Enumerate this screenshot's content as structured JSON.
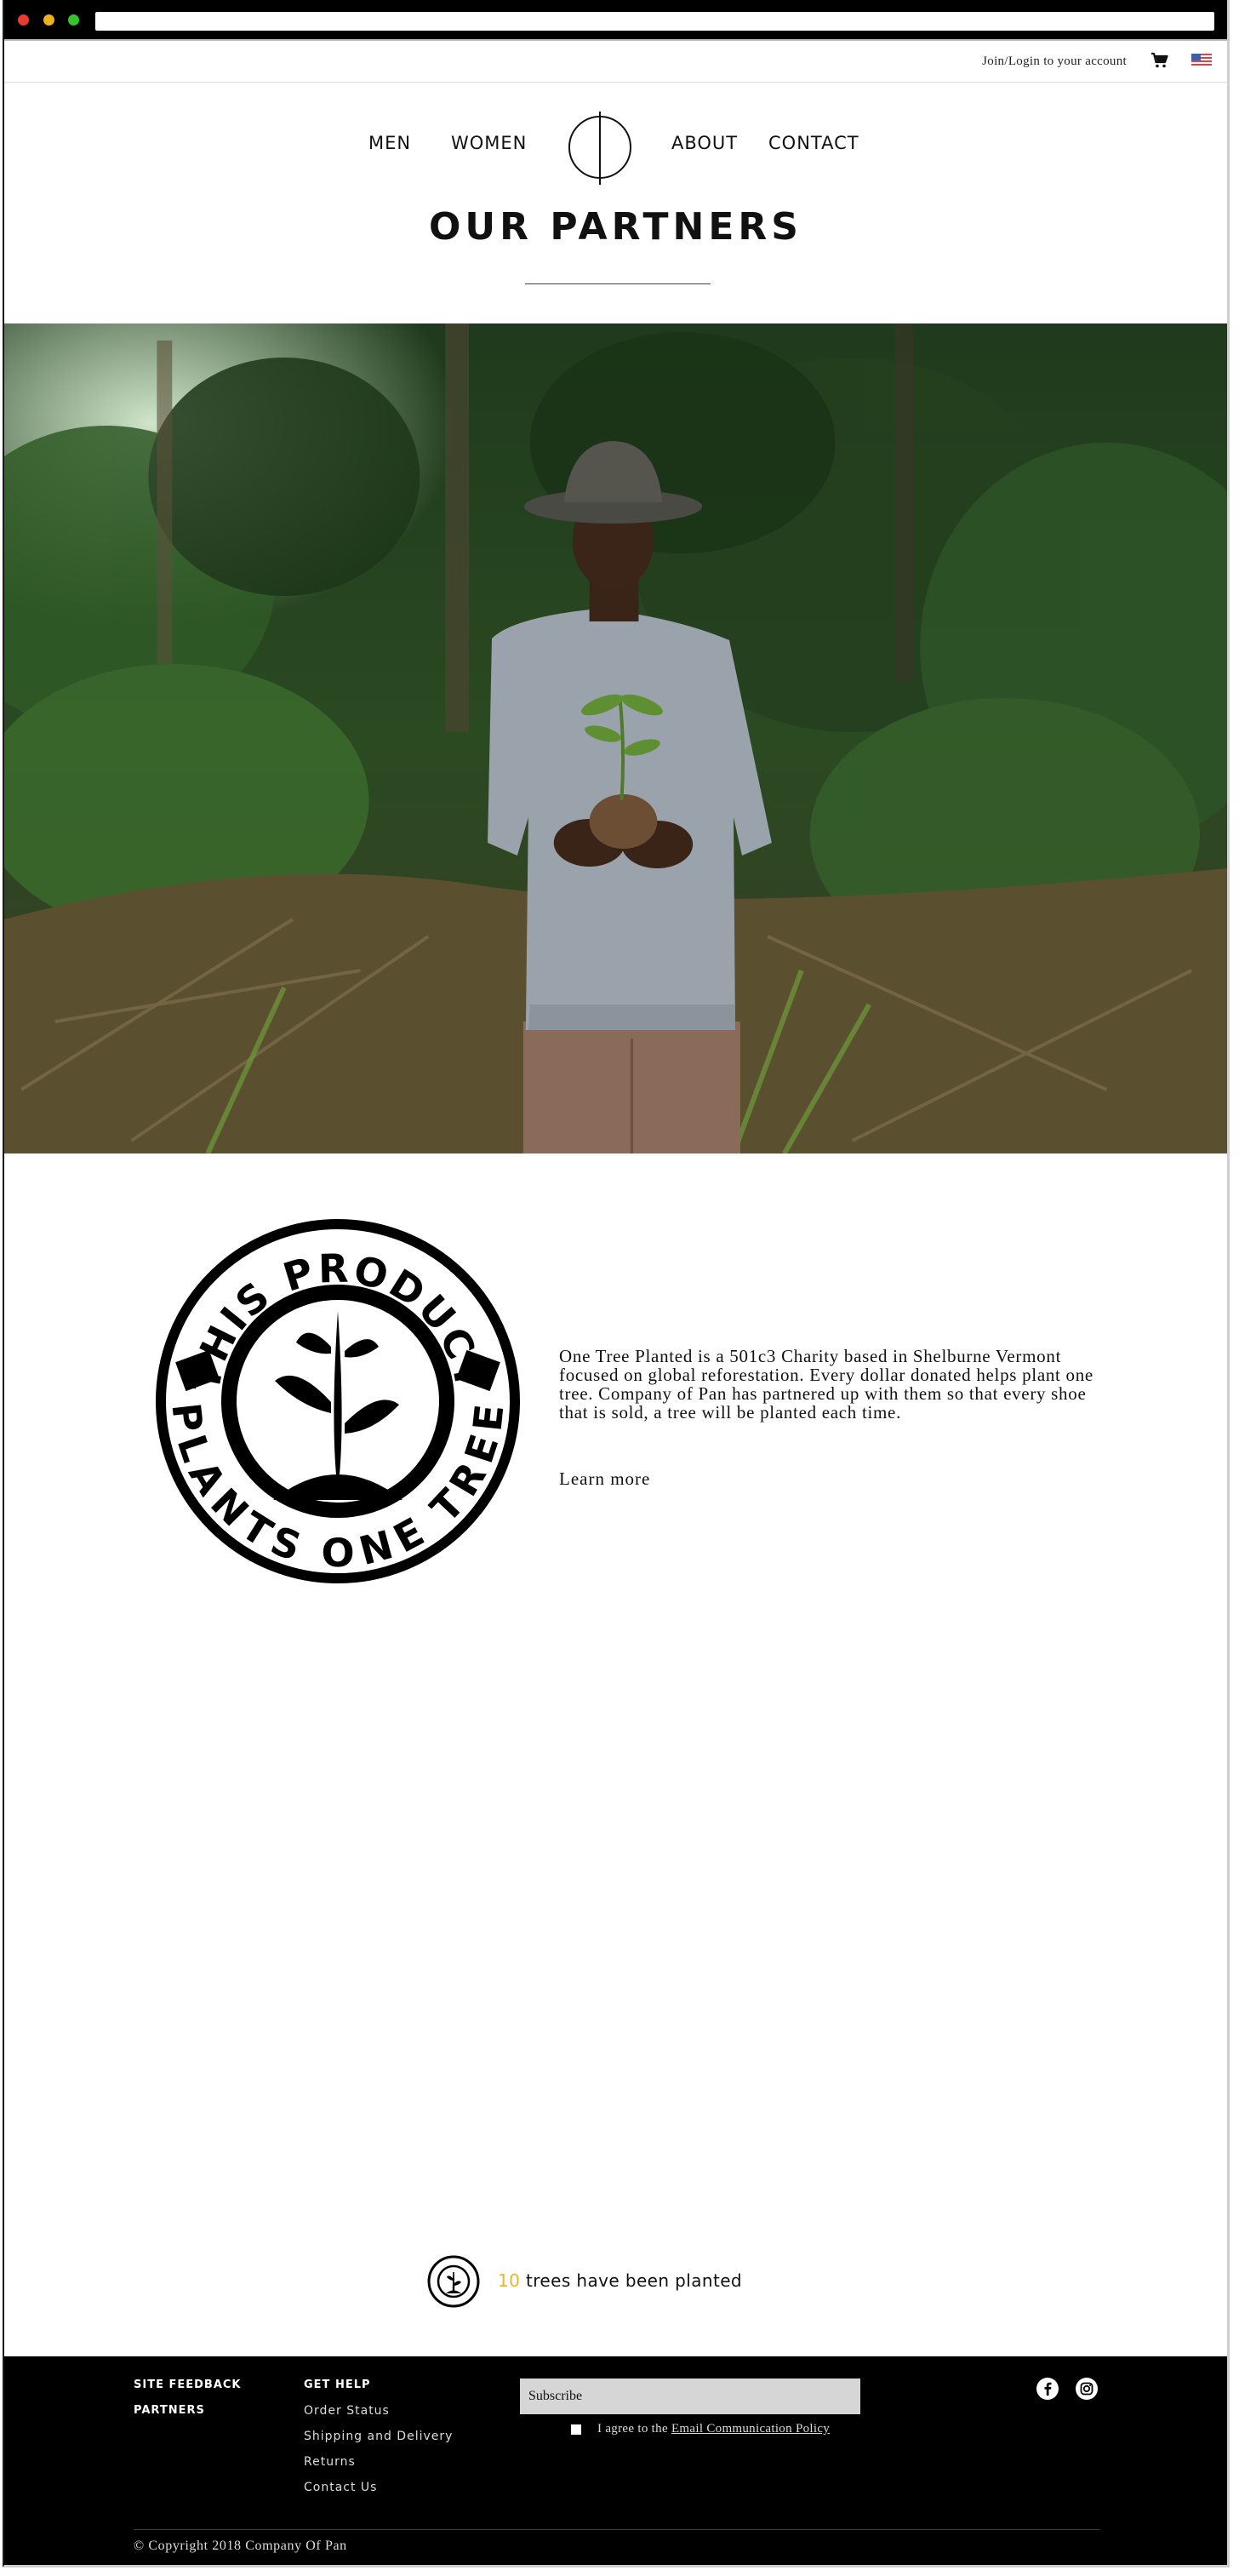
{
  "utility": {
    "login_label": "Join/Login to your account",
    "cart_icon": "cart-icon",
    "flag_icon": "us-flag-icon"
  },
  "nav": {
    "items": [
      {
        "label": "MEN"
      },
      {
        "label": "WOMEN"
      },
      {
        "label": "ABOUT"
      },
      {
        "label": "CONTACT"
      }
    ],
    "logo_icon": "circle-line-logo"
  },
  "page": {
    "title": "OUR PARTNERS"
  },
  "partner": {
    "badge_top_text": "THIS PRODUCT",
    "badge_bottom_text": "PLANTS ONE TREE",
    "description": "One Tree Planted is a 501c3 Charity based in Shelburne Vermont focused on global reforestation. Every dollar donated helps plant one tree. Company of Pan has partnered up with them so that every shoe that is sold, a tree will be planted each time.",
    "learn_more": "Learn more"
  },
  "counter": {
    "count": "10",
    "suffix": " trees have been planted"
  },
  "footer": {
    "col1": [
      {
        "label": "SITE FEEDBACK"
      },
      {
        "label": "PARTNERS"
      }
    ],
    "col2_heading": "GET HELP",
    "col2": [
      {
        "label": "Order Status"
      },
      {
        "label": "Shipping and Delivery"
      },
      {
        "label": "Returns"
      },
      {
        "label": "Contact Us"
      }
    ],
    "subscribe_placeholder": "Subscribe",
    "agree_prefix": "I agree to the ",
    "agree_link": "Email Communication Policy",
    "social": [
      "facebook-icon",
      "instagram-icon"
    ],
    "copyright": "Copyright 2018 Company Of Pan"
  },
  "colors": {
    "accent": "#f0b42a",
    "footer_bg": "#000000",
    "text": "#111111"
  }
}
